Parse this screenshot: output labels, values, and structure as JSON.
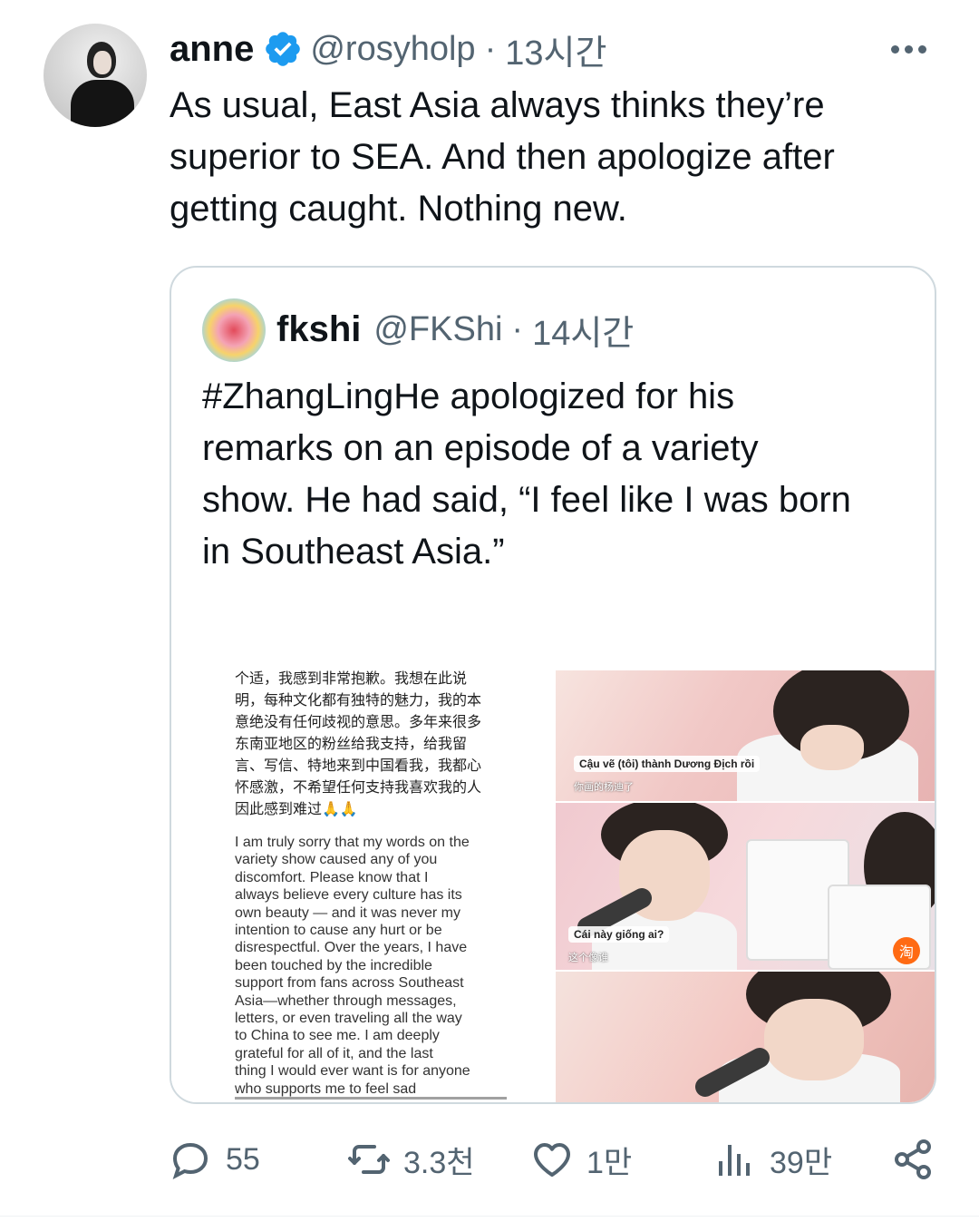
{
  "tweet": {
    "author_name": "anne",
    "handle": "@rosyholp",
    "dot": "·",
    "time": "13시간",
    "lines": [
      "As usual, East Asia always thinks they’re",
      "superior to SEA. And then apologize after",
      "getting caught. Nothing new."
    ]
  },
  "quote": {
    "author_name": "fkshi",
    "handle": "@FKShi",
    "dot": "·",
    "time": "14시간",
    "lines": [
      "#ZhangLingHe apologized for his",
      "remarks on an episode of a variety",
      "show. He had said, “I feel like I was born",
      "in Southeast Asia.”"
    ],
    "ellipsis": "...",
    "image": {
      "statement_zh": [
        "个适，我感到非常抱歉。我想在此说",
        "明，每种文化都有独特的魅力，我的本",
        "意绝没有任何歧视的意思。多年来很多",
        "东南亚地区的粉丝给我支持，给我留",
        "言、写信、特地来到中国看我，我都心",
        "怀感激，不希望任何支持我喜欢我的人",
        "因此感到难过🙏🙏"
      ],
      "statement_en": [
        "I am truly sorry that my words on the",
        "variety show caused any of you",
        "discomfort. Please know that I",
        "always believe every culture has its",
        "own beauty — and it was never my",
        "intention to cause any hurt or be",
        "disrespectful. Over the years, I have",
        "been touched by the incredible",
        "support from fans across Southeast",
        "Asia—whether through messages,",
        "letters, or even traveling all the way",
        "to China to see me. I am deeply",
        "grateful for all of it, and the last",
        "thing I would ever want is for anyone",
        "who supports me to feel sad"
      ],
      "panel1_caption": "Cậu vẽ (tôi) thành Dương Địch rồi",
      "panel1_subcaption": "你画的杨迪了",
      "panel2_caption": "Cái này giống ai?",
      "panel2_subcaption": "这个像谁",
      "panel2_badge": "淘"
    }
  },
  "actions": {
    "replies": "55",
    "retweets": "3.3천",
    "likes": "1만",
    "views": "39만"
  },
  "colors": {
    "text": "#0f1419",
    "secondary": "#536471",
    "verified": "#1d9bf0",
    "border": "#cfd9de"
  },
  "icons": [
    "verified-badge-icon",
    "more-icon",
    "reply-icon",
    "retweet-icon",
    "like-icon",
    "views-icon",
    "share-icon"
  ]
}
